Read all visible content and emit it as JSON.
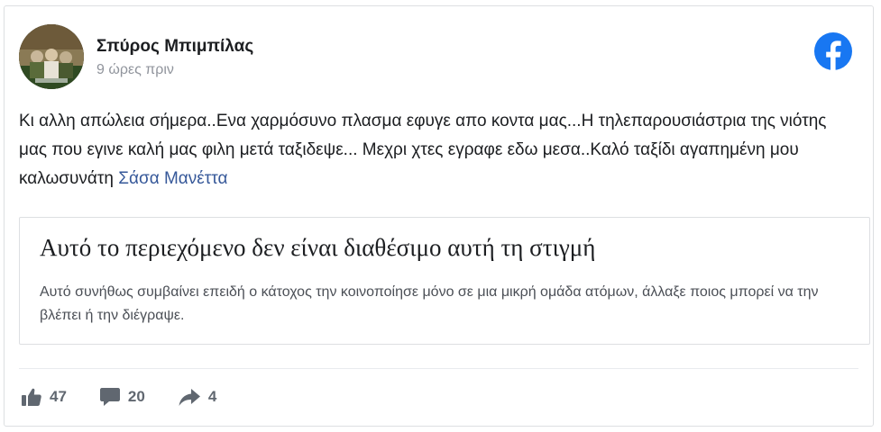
{
  "post": {
    "author": "Σπύρος Μπιμπίλας",
    "time": "9 ώρες πριν",
    "text_plain": "Κι αλλη απώλεια σήμερα..Ενα χαρμόσυνο πλασμα εφυγε απο κοντα μας...Η τηλεπαρουσιάστρια της νιότης μας που εγινε καλή μας φιλη μετά ταξιδεψε... Μεχρι χτες εγραφε εδω μεσα..Καλό ταξίδι αγαπημένη μου καλωσυνάτη ",
    "mention": "Σάσα Μανέττα"
  },
  "unavailable": {
    "title": "Αυτό το περιεχόμενο δεν είναι διαθέσιμο αυτή τη στιγμή",
    "description": "Αυτό συνήθως συμβαίνει επειδή ο κάτοχος την κοινοποίησε μόνο σε μια μικρή ομάδα ατόμων, άλλαξε ποιος μπορεί να την βλέπει ή την διέγραψε."
  },
  "stats": {
    "likes": "47",
    "comments": "20",
    "shares": "4"
  },
  "icons": {
    "brand": "facebook-logo-icon",
    "like": "thumbs-up-icon",
    "comment": "comment-bubble-icon",
    "share": "share-arrow-icon"
  },
  "colors": {
    "facebook_blue": "#1877f2",
    "link_blue": "#365899",
    "muted_gray": "#90949c",
    "action_gray": "#606770"
  }
}
